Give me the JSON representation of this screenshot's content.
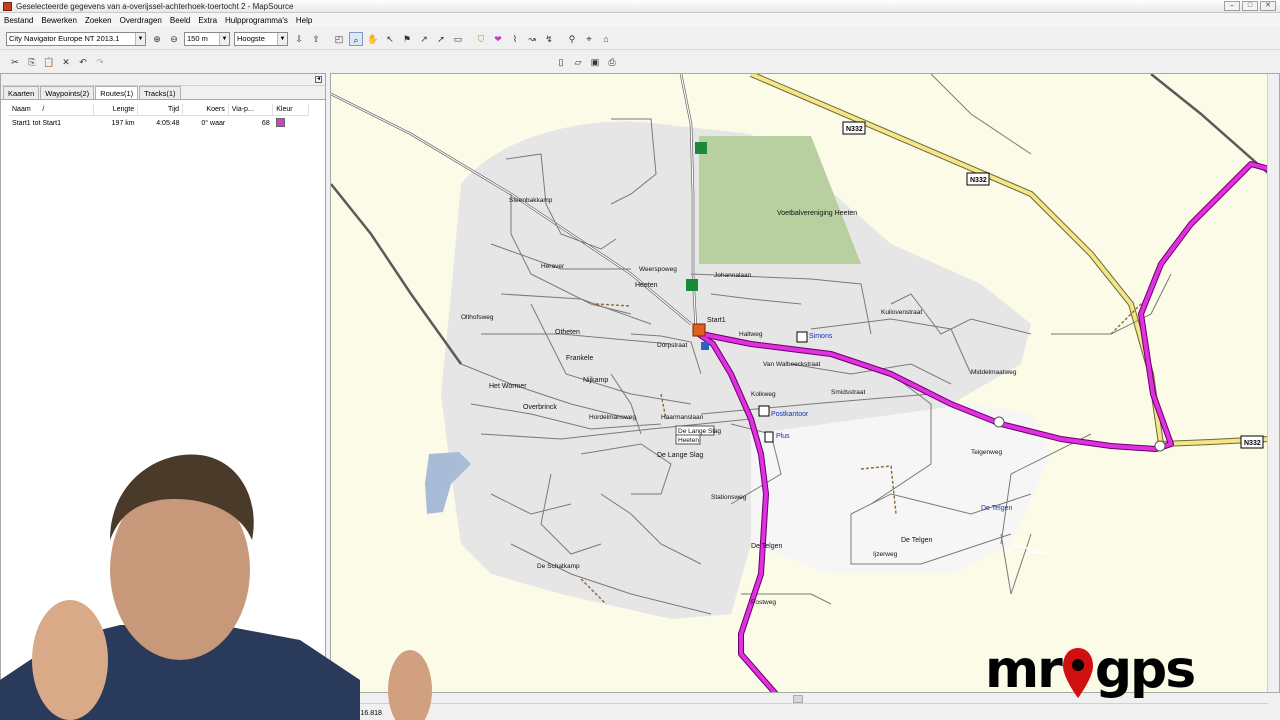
{
  "window": {
    "title": "Geselecteerde gegevens van a-overijssel-achterhoek-toertocht 2 - MapSource",
    "min": "–",
    "max": "□",
    "close": "✕"
  },
  "menu": [
    "Bestand",
    "Bewerken",
    "Zoeken",
    "Overdragen",
    "Beeld",
    "Extra",
    "Hulpprogramma's",
    "Help"
  ],
  "toolbar": {
    "map_product": "City Navigator Europe NT 2013.1",
    "zoom_scale": "150 m",
    "elevation": "Hoogste",
    "icons": [
      "zoom-in-icon",
      "zoom-out-icon"
    ]
  },
  "left_panel": {
    "tabs": [
      "Kaarten",
      "Waypoints(2)",
      "Routes(1)",
      "Tracks(1)"
    ],
    "active_tab": 2,
    "columns": [
      "Naam",
      "Lengte",
      "Tijd",
      "Koers",
      "Via-p...",
      "Kleur"
    ],
    "rows": [
      {
        "name": "Start1 tot Start1",
        "length": "197 km",
        "time": "4:05:48",
        "course": "0° waar",
        "via": "68",
        "color": "#d040d0"
      }
    ],
    "sort_indicator": "/"
  },
  "map": {
    "route_color": "#d020d0",
    "labels": {
      "voetbal": "Voetbalvereniging Heeten",
      "heeten": "Heeten",
      "start1": "Start1",
      "simons": "Simons",
      "postkantoor": "Postkantoor",
      "plus": "Plus",
      "de_telgen": "De Telgen",
      "de_telgen_blue": "De Telgen",
      "de_lange_slag": "De Lange Slag",
      "het_wormer": "Het Wormer",
      "otheten": "Otheten",
      "frankele": "Frankele",
      "nijkamp": "Nijkamp",
      "overbrinck": "Overbrinck",
      "n332a": "N332",
      "n332b": "N332",
      "n332c": "N332",
      "sign1": "De Lange Slag",
      "sign2": "Heeten"
    },
    "roads": {
      "weerspoweg": "Weerspoweg",
      "johannalaan": "Johannalaan",
      "haltweg": "Haltweg",
      "hordelmansweg": "Hordelmansweg",
      "haarmanslaan": "Haarmanslaan",
      "dorpstraat": "Dorpstraat",
      "stationsweg": "Stationsweg",
      "kuilovenstraat": "Kuilovenstraat",
      "van_walbeeckstraat": "Van Walbeeckstraat",
      "de_schatkamp": "De Schatkamp",
      "telgenweg": "Telgenweg",
      "ijzerweg": "Ijzerweg",
      "postweg": "Postweg",
      "heraver": "Heraver",
      "steenbakkamp": "Steenbakkamp",
      "molenweg": "Middelmaatweg",
      "olthofsweg": "Olthofsweg",
      "kolkweg": "Kolkweg",
      "smidsstraat": "Smidsstraat"
    }
  },
  "status": {
    "coords": "E6 16.818"
  },
  "watermark": {
    "brand_left": "mr",
    "brand_right": "gps"
  }
}
